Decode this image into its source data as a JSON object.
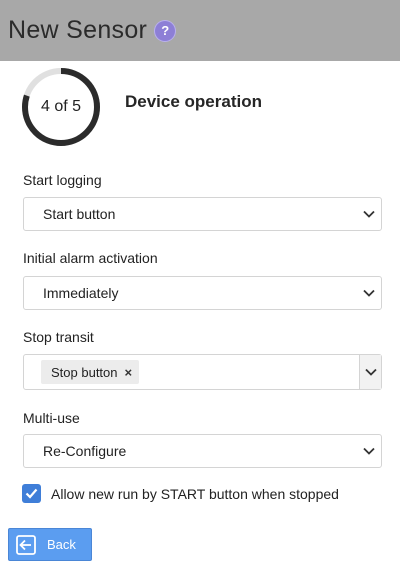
{
  "header": {
    "title": "New Sensor",
    "help_icon": "question-circle-icon",
    "help_glyph": "?"
  },
  "progress": {
    "label": "4 of 5",
    "current_step": 4,
    "total_steps": 5
  },
  "step_title": "Device operation",
  "fields": {
    "start_logging": {
      "label": "Start logging",
      "value": "Start button"
    },
    "initial_alarm": {
      "label": "Initial alarm activation",
      "value": "Immediately"
    },
    "stop_transit": {
      "label": "Stop transit",
      "chips": [
        "Stop button"
      ],
      "chip_remove_glyph": "×"
    },
    "multi_use": {
      "label": "Multi-use",
      "value": "Re-Configure"
    }
  },
  "checkbox": {
    "checked": true,
    "label": "Allow new run by START button when stopped"
  },
  "back_button": {
    "label": "Back",
    "icon": "arrow-left-box-icon"
  },
  "colors": {
    "header_bg": "#a8a8a8",
    "accent": "#5b9df0",
    "checkbox": "#3f7ed8",
    "progress_ring": "#2b2b2b",
    "progress_track": "#e0e0e0"
  }
}
